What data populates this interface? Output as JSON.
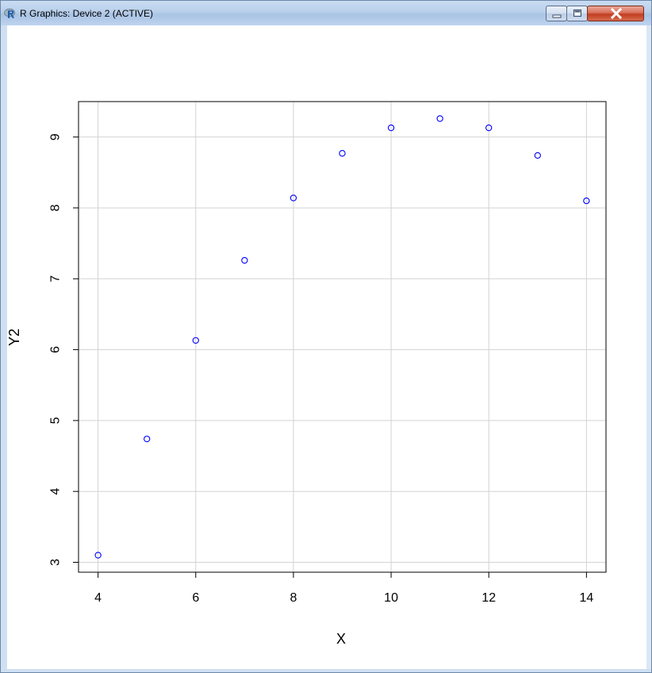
{
  "window": {
    "title": "R Graphics: Device 2 (ACTIVE)",
    "app_icon": "r-logo-icon",
    "controls": {
      "minimize_icon": "minimize-icon",
      "maximize_icon": "maximize-icon",
      "close_icon": "close-icon"
    }
  },
  "colors": {
    "point": "#0000ff",
    "grid": "#d3d3d3",
    "axis": "#000000",
    "close_button": "#c94a2e"
  },
  "chart_data": {
    "type": "scatter",
    "title": "",
    "xlabel": "X",
    "ylabel": "Y2",
    "xlim": [
      3.6,
      14.4
    ],
    "ylim": [
      2.86,
      9.5
    ],
    "xticks": [
      4,
      6,
      8,
      10,
      12,
      14
    ],
    "yticks": [
      3,
      4,
      5,
      6,
      7,
      8,
      9
    ],
    "grid_x": [
      4,
      6,
      8,
      10,
      12,
      14
    ],
    "grid_y": [
      3,
      4,
      5,
      6,
      7,
      8,
      9
    ],
    "grid": true,
    "marker": "open-circle",
    "series": [
      {
        "x": [
          4,
          5,
          6,
          7,
          8,
          9,
          10,
          11,
          12,
          13,
          14
        ],
        "y": [
          3.1,
          4.74,
          6.13,
          7.26,
          8.14,
          8.77,
          9.13,
          9.26,
          9.13,
          8.74,
          8.1
        ]
      }
    ]
  }
}
